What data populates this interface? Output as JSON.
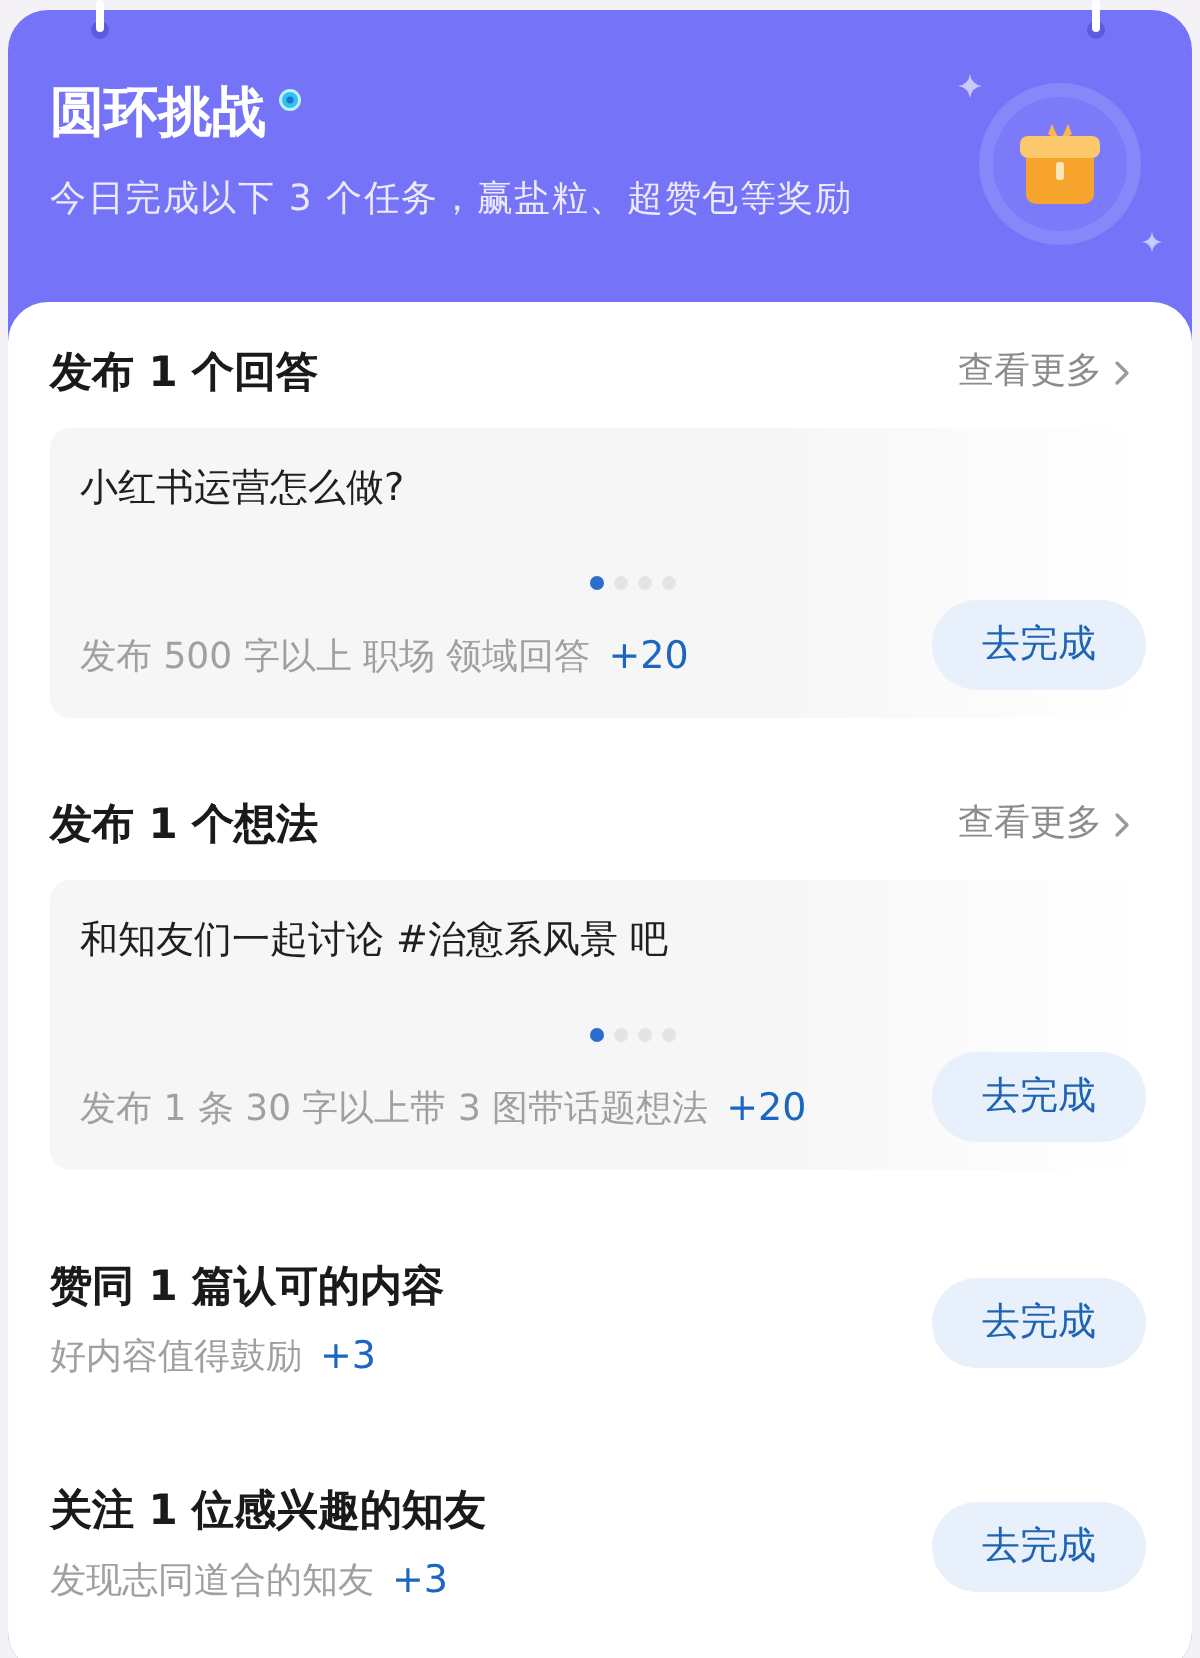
{
  "header": {
    "title": "圆环挑战",
    "subtitle": "今日完成以下 3 个任务，赢盐粒、超赞包等奖励"
  },
  "tasks": [
    {
      "kind": "carousel",
      "title": "发布 1 个回答",
      "more": "查看更多",
      "prompt": "小红书运营怎么做?",
      "pages": [
        {
          "selected": true
        },
        {
          "selected": false
        },
        {
          "selected": false
        },
        {
          "selected": false
        }
      ],
      "requirement": "发布 500 字以上 职场 领域回答",
      "reward": "+20",
      "button": "去完成"
    },
    {
      "kind": "carousel",
      "title": "发布 1 个想法",
      "more": "查看更多",
      "prompt": "和知友们一起讨论 #治愈系风景 吧",
      "pages": [
        {
          "selected": true
        },
        {
          "selected": false
        },
        {
          "selected": false
        },
        {
          "selected": false
        }
      ],
      "requirement": "发布 1 条 30 字以上带 3 图带话题想法",
      "reward": "+20",
      "button": "去完成"
    },
    {
      "kind": "simple",
      "title": "赞同 1 篇认可的内容",
      "requirement": "好内容值得鼓励",
      "reward": "+3",
      "button": "去完成"
    },
    {
      "kind": "simple",
      "title": "关注 1 位感兴趣的知友",
      "requirement": "发现志同道合的知友",
      "reward": "+3",
      "button": "去完成"
    }
  ]
}
